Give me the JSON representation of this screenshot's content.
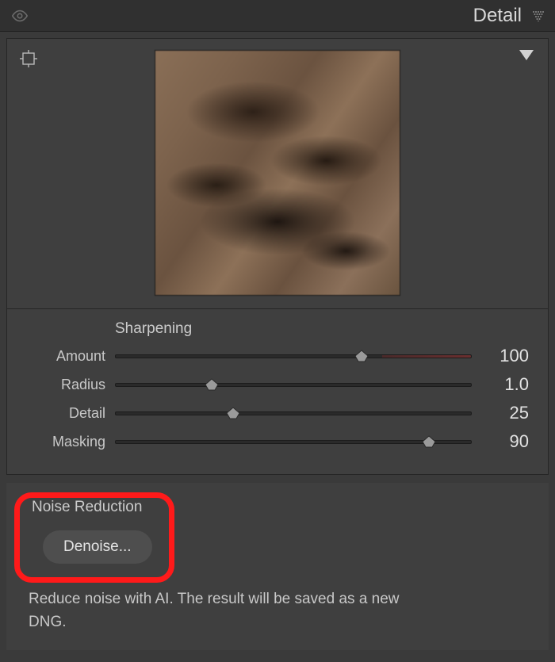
{
  "panel": {
    "title": "Detail"
  },
  "sharpening": {
    "heading": "Sharpening",
    "sliders": {
      "amount": {
        "label": "Amount",
        "value": "100",
        "percent": 69
      },
      "radius": {
        "label": "Radius",
        "value": "1.0",
        "percent": 27
      },
      "detail": {
        "label": "Detail",
        "value": "25",
        "percent": 33
      },
      "masking": {
        "label": "Masking",
        "value": "90",
        "percent": 88
      }
    }
  },
  "noise": {
    "heading": "Noise Reduction",
    "button": "Denoise...",
    "description": "Reduce noise with AI. The result will be saved as a new DNG."
  }
}
